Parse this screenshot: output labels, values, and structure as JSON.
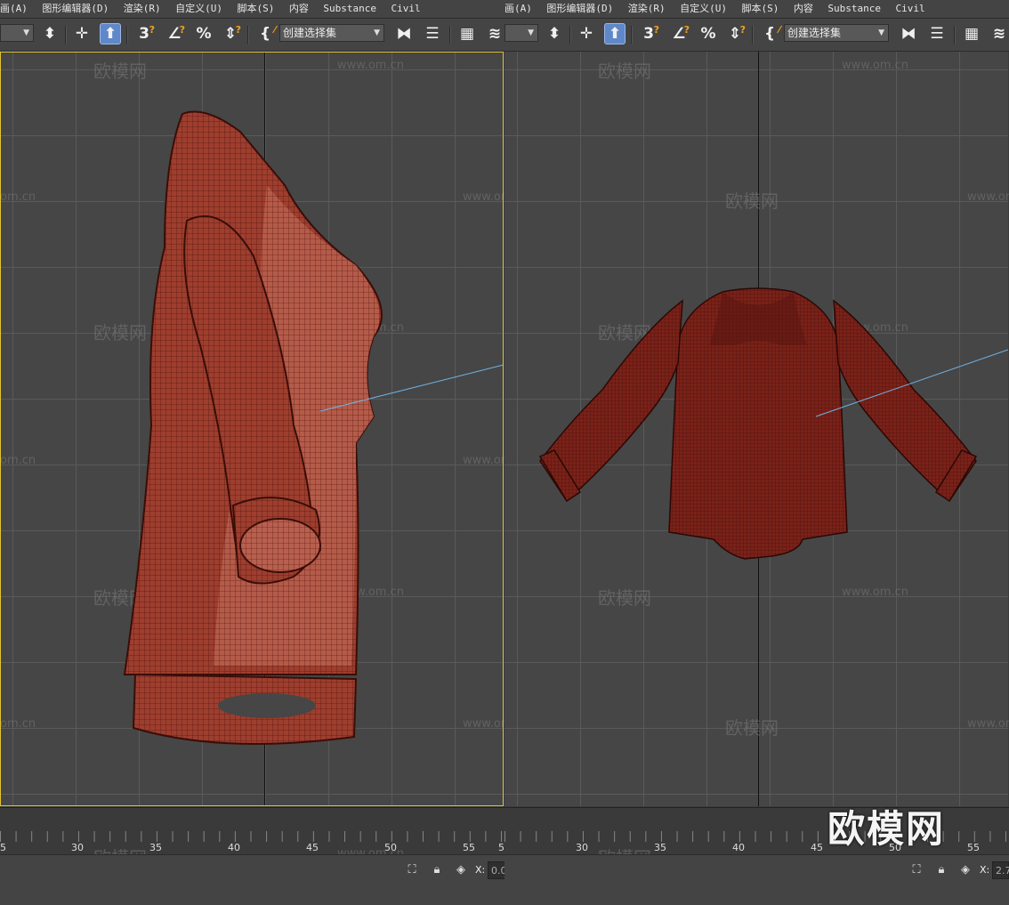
{
  "menu": [
    "画(A)",
    "图形编辑器(D)",
    "渲染(R)",
    "自定义(U)",
    "脚本(S)",
    "内容",
    "Substance",
    "Civil"
  ],
  "toolbar": {
    "icon_3": "3",
    "icon_pct": "%",
    "selection_set_placeholder": "创建选择集"
  },
  "timeline_ticks_left": [
    "5",
    "30",
    "35",
    "40",
    "45",
    "50",
    "55",
    "5"
  ],
  "timeline_ticks_right": [
    "30",
    "35",
    "40",
    "45",
    "50",
    "55"
  ],
  "status": {
    "x_label": "X:",
    "x_value_left": "0.0",
    "x_value_right": "2.7"
  },
  "watermark": {
    "site": "www.om.cn",
    "short": "om.cn",
    "brand": "欧模网"
  },
  "colors": {
    "accent": "#e4c42c",
    "active_button": "#5e88c9",
    "mesh": "#9c3b2c",
    "helper_line": "#6fb4e8"
  }
}
